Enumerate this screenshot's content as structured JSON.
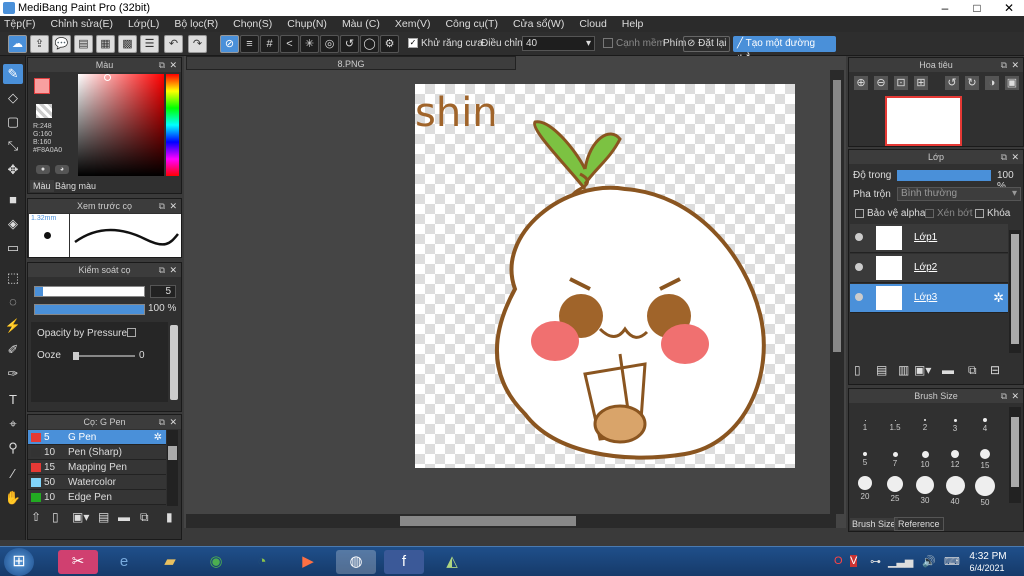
{
  "window": {
    "title": "MediBang Paint Pro (32bit)",
    "min": "–",
    "max": "□",
    "close": "✕"
  },
  "menu": [
    "Tệp(F)",
    "Chỉnh sửa(E)",
    "Lớp(L)",
    "Bộ lọc(R)",
    "Chọn(S)",
    "Chụp(N)",
    "Màu (C)",
    "Xem(V)",
    "Công cụ(T)",
    "Cửa sổ(W)",
    "Cloud",
    "Help"
  ],
  "toolbar": {
    "antialias_label": "Khử răng cưa",
    "adjust_label": "Điều chỉnh",
    "adjust_value": "40",
    "snap_label": "Cạnh mềm",
    "key_label": "Phím",
    "reset_label": "Đặt lại",
    "straight_label": "Tạo một đường thẳng"
  },
  "color_panel": {
    "title": "Màu",
    "r": "R:248",
    "g": "G:160",
    "b": "B:160",
    "hex": "#F8A0A0",
    "tab_color": "Màu",
    "tab_palette": "Bảng màu",
    "primary": "#F8A0A0"
  },
  "brush_preview": {
    "title": "Xem trước cọ",
    "size": "1.32mm"
  },
  "brush_control": {
    "title": "Kiểm soát cọ",
    "size_value": "5",
    "opacity_value": "100 %",
    "opacity_pressure": "Opacity by Pressure",
    "ooze_label": "Ooze",
    "ooze_value": "0"
  },
  "brush_list": {
    "title": "Cọ: G Pen",
    "items": [
      {
        "color": "#e53935",
        "size": "5",
        "name": "G Pen",
        "selected": true
      },
      {
        "color": "#333333",
        "size": "10",
        "name": "Pen (Sharp)",
        "selected": false
      },
      {
        "color": "#e53935",
        "size": "15",
        "name": "Mapping Pen",
        "selected": false
      },
      {
        "color": "#81d4fa",
        "size": "50",
        "name": "Watercolor",
        "selected": false
      },
      {
        "color": "#22aa22",
        "size": "10",
        "name": "Edge Pen",
        "selected": false
      }
    ]
  },
  "document": {
    "tab": "8.PNG",
    "art_text": "shin"
  },
  "navigator": {
    "title": "Hoa tiêu"
  },
  "layer_panel": {
    "title": "Lớp",
    "opacity_label": "Độ trong",
    "opacity_value": "100 %",
    "blend_label": "Pha trộn",
    "blend_value": "Bình thường",
    "protect_alpha": "Bảo vệ alpha",
    "clipping": "Xén bớt",
    "lock": "Khóa",
    "layers": [
      {
        "name": "Lớp1",
        "selected": false
      },
      {
        "name": "Lớp2",
        "selected": false
      },
      {
        "name": "Lớp3",
        "selected": true
      }
    ]
  },
  "brush_size": {
    "title": "Brush Size",
    "tab_size": "Brush Size",
    "tab_ref": "Reference",
    "sizes": [
      "1",
      "1.5",
      "2",
      "3",
      "4",
      "5",
      "7",
      "10",
      "12",
      "15",
      "20",
      "25",
      "30",
      "40",
      "50"
    ]
  },
  "taskbar": {
    "time": "4:32 PM",
    "date": "6/4/2021"
  }
}
